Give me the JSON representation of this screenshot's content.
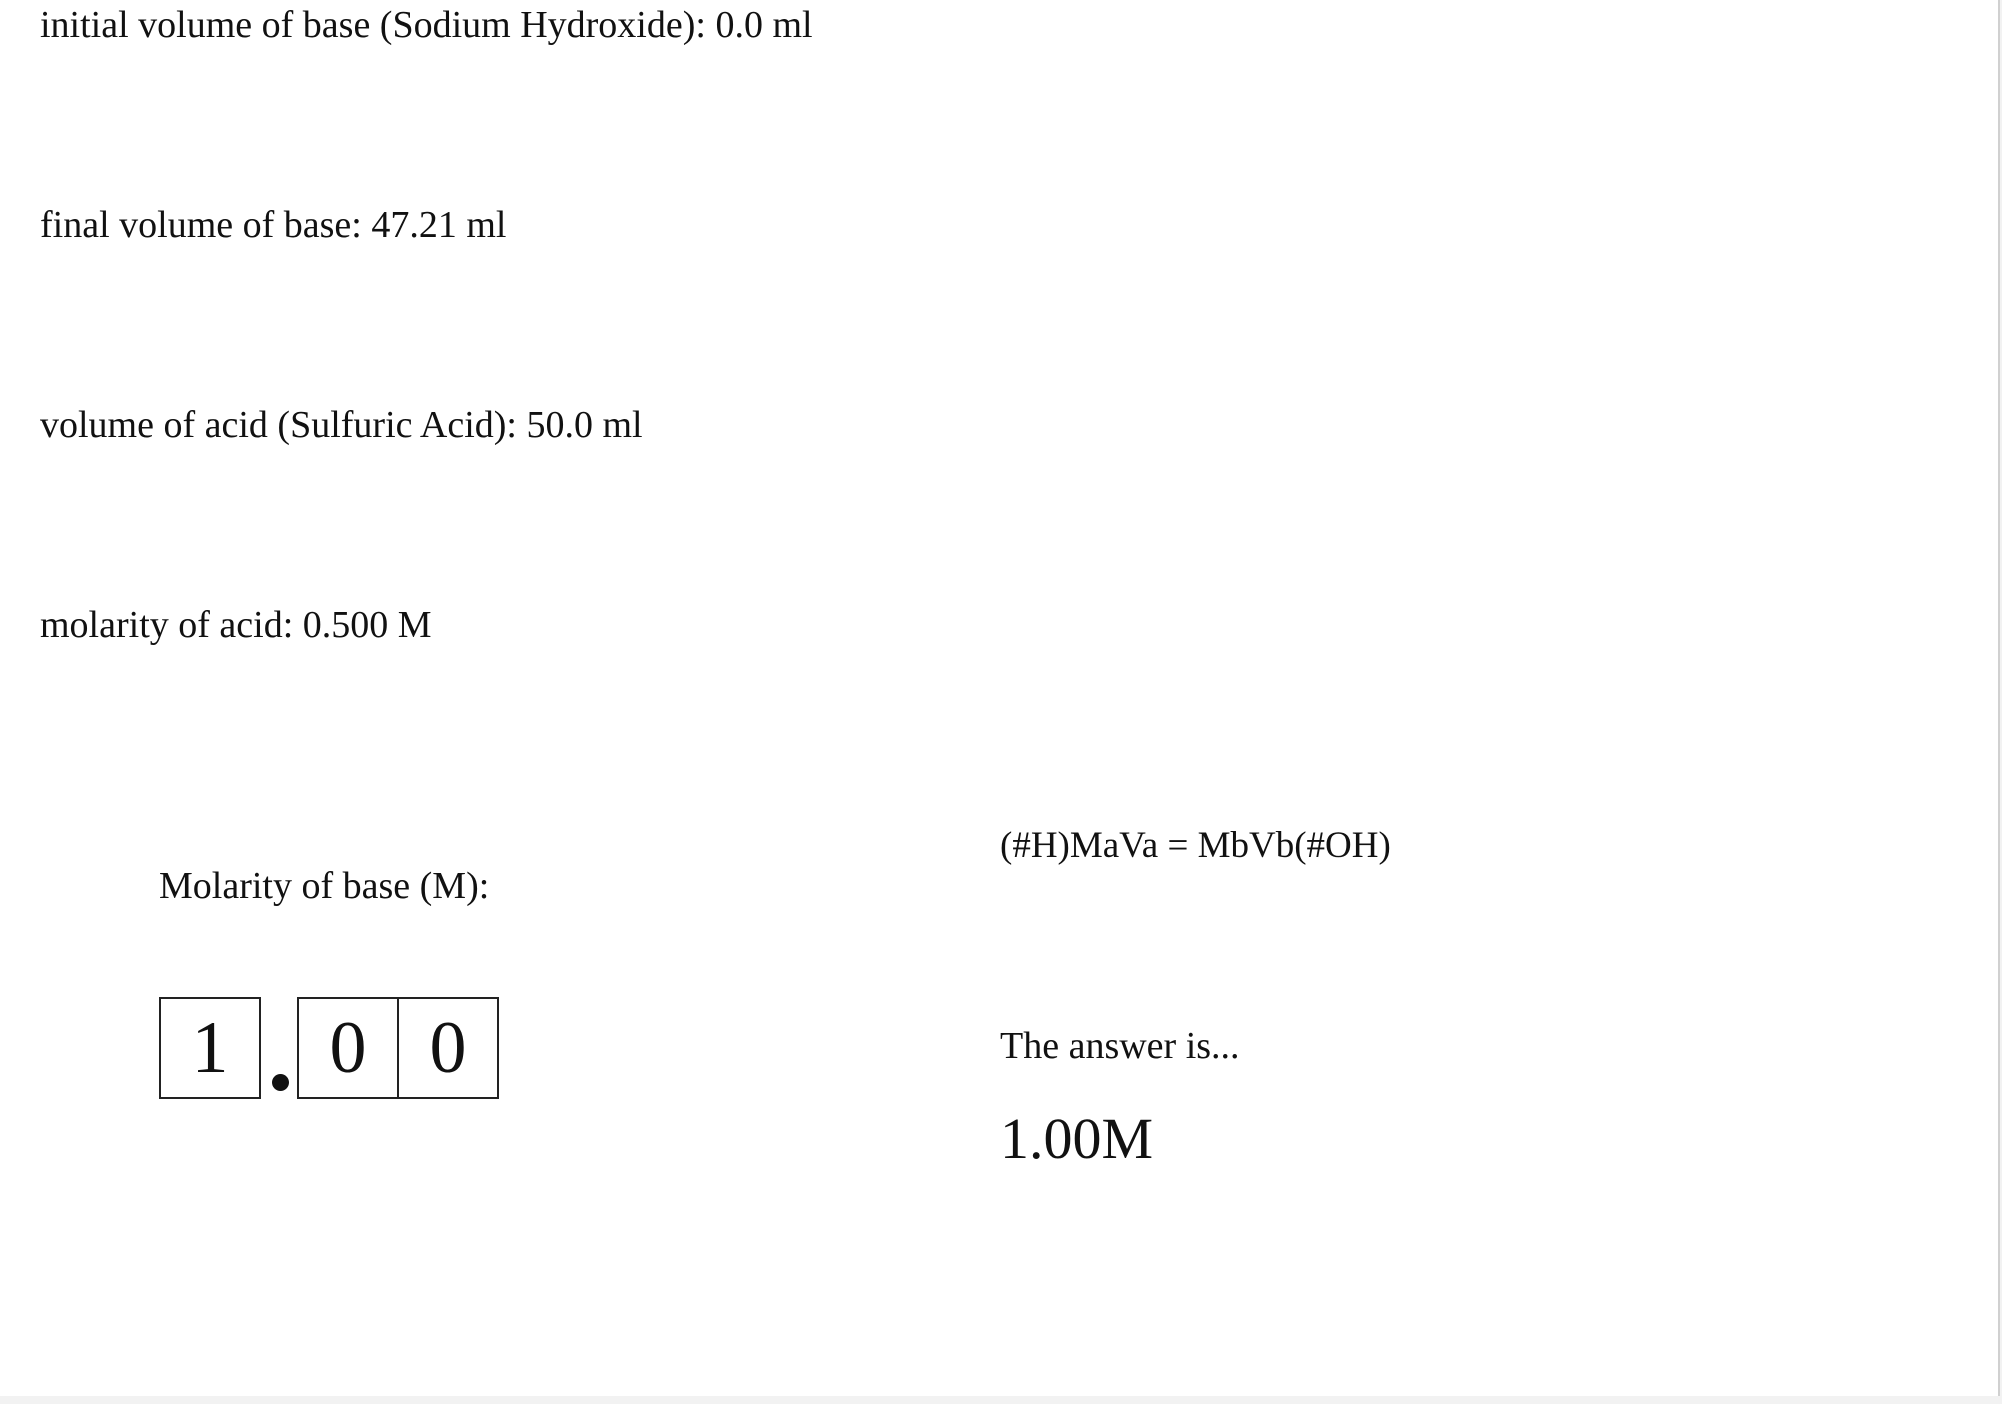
{
  "given": {
    "initial_base_volume": "initial volume of base (Sodium Hydroxide): 0.0 ml",
    "final_base_volume": "final volume of base: 47.21 ml",
    "acid_volume": "volume of acid (Sulfuric Acid): 50.0 ml",
    "acid_molarity": "molarity of acid: 0.500 M"
  },
  "answer_entry": {
    "label": "Molarity of base (M):",
    "digits": [
      "1",
      "0",
      "0"
    ],
    "decimal_after_digit": 1
  },
  "help": {
    "formula": "(#H)MaVa = MbVb(#OH)",
    "answer_intro": "The answer is...",
    "answer_value": "1.00M"
  }
}
